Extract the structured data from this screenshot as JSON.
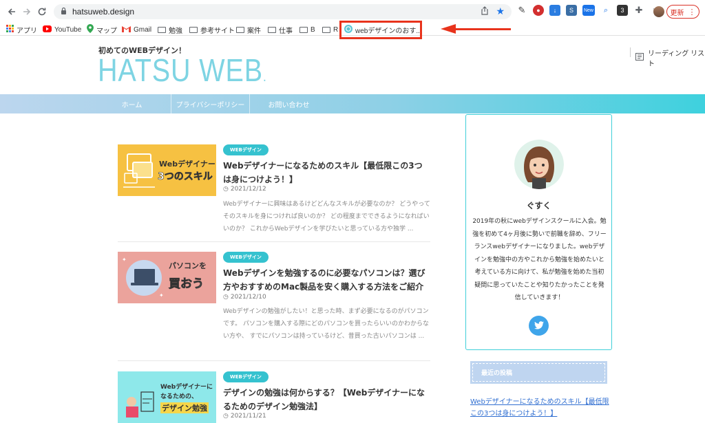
{
  "browser": {
    "url": "hatsuweb.design",
    "update_label": "更新",
    "reading_list_label": "リーディング リスト",
    "bookmarks": [
      {
        "label": "アプリ",
        "icon": "apps-grid-icon"
      },
      {
        "label": "YouTube",
        "icon": "youtube-icon"
      },
      {
        "label": "マップ",
        "icon": "maps-pin-icon"
      },
      {
        "label": "Gmail",
        "icon": "gmail-icon"
      },
      {
        "label": "勉強",
        "icon": "folder-icon"
      },
      {
        "label": "参考サイト",
        "icon": "folder-icon"
      },
      {
        "label": "案件",
        "icon": "folder-icon"
      },
      {
        "label": "仕事",
        "icon": "folder-icon"
      },
      {
        "label": "B",
        "icon": "folder-icon"
      },
      {
        "label": "R",
        "icon": "folder-icon"
      },
      {
        "label": "webデザインのおす...",
        "icon": "site-favicon"
      }
    ],
    "ext_new_label": "New",
    "ext_count_label": "3"
  },
  "site": {
    "tagline": "初めてのWEBデザイン！",
    "logo": "HATSU WEB",
    "nav": [
      "ホーム",
      "プライバシーポリシー",
      "お問い合わせ"
    ]
  },
  "articles": [
    {
      "badge": "WEBデザイン",
      "title": "Webデザイナーになるためのスキル【最低限この3つは身につけよう！】",
      "date": "2021/12/12",
      "excerpt": "Webデザイナーに興味はあるけどどんなスキルが必要なのか？ どうやってそのスキルを身につければ良いのか？ どの程度までできるようになればいいのか？ これからWebデザインを学びたいと思っている方や独学 ...",
      "thumb_text_1": "Webデザイナー",
      "thumb_text_2": "3つのスキル"
    },
    {
      "badge": "WEBデザイン",
      "title": "Webデザインを勉強するのに必要なパソコンは？選び方やおすすめのMac製品を安く購入する方法をご紹介",
      "date": "2021/12/10",
      "excerpt": "Webデザインの勉強がしたい！と思った時、まず必要になるのがパソコンです。 パソコンを購入する際にどのパソコンを買ったらいいのかわからない方や、 すでにパソコンは持っているけど、昔買った古いパソコンは ...",
      "thumb_text_1": "パソコンを",
      "thumb_text_2": "買おう"
    },
    {
      "badge": "WEBデザイン",
      "title": "デザインの勉強は何からする？【Webデザイナーになるためのデザイン勉強法】",
      "date": "2021/11/21",
      "excerpt": "",
      "thumb_text_1": "Webデザイナーに",
      "thumb_text_2": "なるための、",
      "thumb_text_3": "デザイン勉強"
    }
  ],
  "profile": {
    "name": "ぐすく",
    "bio": "2019年の秋にwebデザインスクールに入会。勉強を初めて4ヶ月後に勢いで前職を辞め、フリーランスwebデザイナーになりました。webデザインを勉強中の方やこれから勉強を始めたいと考えている方に向けて、私が勉強を始めた当初疑問に思っていたことや知りたかったことを発信していきます！"
  },
  "recent": {
    "header": "最近の投稿",
    "link": "Webデザイナーになるためのスキル【最低限この3つは身につけよう！】"
  },
  "colors": {
    "accent": "#35c2cf",
    "highlight": "#e8331c",
    "link": "#2f6ed1"
  }
}
